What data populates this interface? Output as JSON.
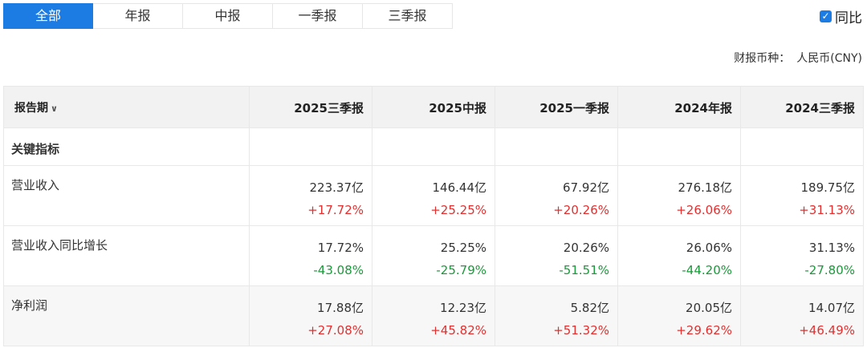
{
  "tabs": [
    {
      "label": "全部",
      "active": true
    },
    {
      "label": "年报",
      "active": false
    },
    {
      "label": "中报",
      "active": false
    },
    {
      "label": "一季报",
      "active": false
    },
    {
      "label": "三季报",
      "active": false
    }
  ],
  "yoy_toggle": {
    "label": "同比",
    "checked": true
  },
  "currency": {
    "label": "财报币种：",
    "value": "人民币(CNY)"
  },
  "colors": {
    "accent": "#1d7ce3",
    "increase": "#e03030",
    "decrease": "#1a9a3a"
  },
  "table": {
    "period_header": "报告期",
    "columns": [
      "2025三季报",
      "2025中报",
      "2025一季报",
      "2024年报",
      "2024三季报"
    ],
    "section": "关键指标",
    "rows": [
      {
        "name": "营业收入",
        "values": [
          "223.37亿",
          "146.44亿",
          "67.92亿",
          "276.18亿",
          "189.75亿"
        ],
        "changes": [
          "+17.72%",
          "+25.25%",
          "+20.26%",
          "+26.06%",
          "+31.13%"
        ],
        "directions": [
          "up",
          "up",
          "up",
          "up",
          "up"
        ]
      },
      {
        "name": "营业收入同比增长",
        "values": [
          "17.72%",
          "25.25%",
          "20.26%",
          "26.06%",
          "31.13%"
        ],
        "changes": [
          "-43.08%",
          "-25.79%",
          "-51.51%",
          "-44.20%",
          "-27.80%"
        ],
        "directions": [
          "down",
          "down",
          "down",
          "down",
          "down"
        ]
      },
      {
        "name": "净利润",
        "values": [
          "17.88亿",
          "12.23亿",
          "5.82亿",
          "20.05亿",
          "14.07亿"
        ],
        "changes": [
          "+27.08%",
          "+45.82%",
          "+51.32%",
          "+29.62%",
          "+46.49%"
        ],
        "directions": [
          "up",
          "up",
          "up",
          "up",
          "up"
        ]
      }
    ]
  }
}
